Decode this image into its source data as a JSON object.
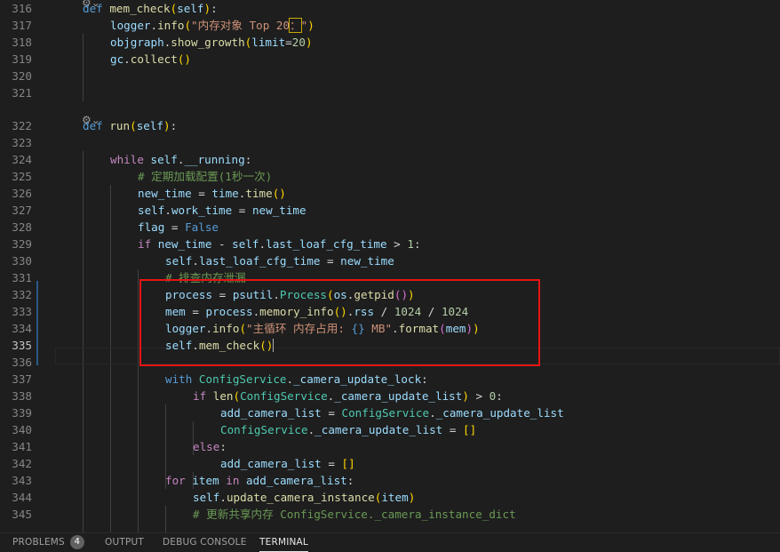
{
  "editor": {
    "lines": [
      {
        "n": "316",
        "seg": [
          [
            "kw",
            "def "
          ],
          [
            "fn",
            "mem_check"
          ],
          [
            "br1",
            "("
          ],
          [
            "var",
            "self"
          ],
          [
            "br1",
            ")"
          ],
          [
            "op",
            ":"
          ]
        ]
      },
      {
        "n": "317",
        "seg": [
          [
            "var",
            "logger"
          ],
          [
            "op",
            "."
          ],
          [
            "fn",
            "info"
          ],
          [
            "br1",
            "("
          ],
          [
            "str",
            "\"内存对象 Top 20"
          ],
          [
            "strhl",
            "："
          ],
          [
            "str",
            "\""
          ],
          [
            "br1",
            ")"
          ]
        ]
      },
      {
        "n": "318",
        "seg": [
          [
            "var",
            "objgraph"
          ],
          [
            "op",
            "."
          ],
          [
            "fn",
            "show_growth"
          ],
          [
            "br1",
            "("
          ],
          [
            "var",
            "limit"
          ],
          [
            "op",
            "="
          ],
          [
            "num",
            "20"
          ],
          [
            "br1",
            ")"
          ]
        ]
      },
      {
        "n": "319",
        "seg": [
          [
            "var",
            "gc"
          ],
          [
            "op",
            "."
          ],
          [
            "fn",
            "collect"
          ],
          [
            "br1",
            "()"
          ]
        ]
      },
      {
        "n": "320",
        "seg": []
      },
      {
        "n": "321",
        "seg": []
      },
      {
        "n": "322",
        "seg": [
          [
            "kw",
            "def "
          ],
          [
            "fn",
            "run"
          ],
          [
            "br1",
            "("
          ],
          [
            "var",
            "self"
          ],
          [
            "br1",
            ")"
          ],
          [
            "op",
            ":"
          ]
        ]
      },
      {
        "n": "323",
        "seg": []
      },
      {
        "n": "324",
        "seg": [
          [
            "ctl",
            "while "
          ],
          [
            "var",
            "self"
          ],
          [
            "op",
            "."
          ],
          [
            "var",
            "__running"
          ],
          [
            "op",
            ":"
          ]
        ]
      },
      {
        "n": "325",
        "seg": [
          [
            "cmt",
            "# 定期加载配置(1秒一次)"
          ]
        ]
      },
      {
        "n": "326",
        "seg": [
          [
            "var",
            "new_time"
          ],
          [
            "op",
            " = "
          ],
          [
            "var",
            "time"
          ],
          [
            "op",
            "."
          ],
          [
            "fn",
            "time"
          ],
          [
            "br1",
            "()"
          ]
        ]
      },
      {
        "n": "327",
        "seg": [
          [
            "var",
            "self"
          ],
          [
            "op",
            "."
          ],
          [
            "var",
            "work_time"
          ],
          [
            "op",
            " = "
          ],
          [
            "var",
            "new_time"
          ]
        ]
      },
      {
        "n": "328",
        "seg": [
          [
            "var",
            "flag"
          ],
          [
            "op",
            " = "
          ],
          [
            "kw",
            "False"
          ]
        ]
      },
      {
        "n": "329",
        "seg": [
          [
            "ctl",
            "if "
          ],
          [
            "var",
            "new_time"
          ],
          [
            "op",
            " - "
          ],
          [
            "var",
            "self"
          ],
          [
            "op",
            "."
          ],
          [
            "var",
            "last_loaf_cfg_time"
          ],
          [
            "op",
            " > "
          ],
          [
            "num",
            "1"
          ],
          [
            "op",
            ":"
          ]
        ]
      },
      {
        "n": "330",
        "seg": [
          [
            "var",
            "self"
          ],
          [
            "op",
            "."
          ],
          [
            "var",
            "last_loaf_cfg_time"
          ],
          [
            "op",
            " = "
          ],
          [
            "var",
            "new_time"
          ]
        ]
      },
      {
        "n": "331",
        "seg": [
          [
            "cmt",
            "# 排查内存泄漏"
          ]
        ]
      },
      {
        "n": "332",
        "seg": [
          [
            "var",
            "process"
          ],
          [
            "op",
            " = "
          ],
          [
            "var",
            "psutil"
          ],
          [
            "op",
            "."
          ],
          [
            "cls",
            "Process"
          ],
          [
            "br1",
            "("
          ],
          [
            "var",
            "os"
          ],
          [
            "op",
            "."
          ],
          [
            "fn",
            "getpid"
          ],
          [
            "br2",
            "()"
          ],
          [
            "br1",
            ")"
          ]
        ]
      },
      {
        "n": "333",
        "seg": [
          [
            "var",
            "mem"
          ],
          [
            "op",
            " = "
          ],
          [
            "var",
            "process"
          ],
          [
            "op",
            "."
          ],
          [
            "fn",
            "memory_info"
          ],
          [
            "br1",
            "()"
          ],
          [
            "op",
            "."
          ],
          [
            "var",
            "rss"
          ],
          [
            "op",
            " / "
          ],
          [
            "num",
            "1024"
          ],
          [
            "op",
            " / "
          ],
          [
            "num",
            "1024"
          ]
        ]
      },
      {
        "n": "334",
        "seg": [
          [
            "var",
            "logger"
          ],
          [
            "op",
            "."
          ],
          [
            "fn",
            "info"
          ],
          [
            "br1",
            "("
          ],
          [
            "str",
            "\"主循环 内存占用: "
          ],
          [
            "kw",
            "{}"
          ],
          [
            "str",
            " MB\""
          ],
          [
            "op",
            "."
          ],
          [
            "fn",
            "format"
          ],
          [
            "br2",
            "("
          ],
          [
            "var",
            "mem"
          ],
          [
            "br2",
            ")"
          ],
          [
            "br1",
            ")"
          ]
        ]
      },
      {
        "n": "335",
        "seg": [
          [
            "var",
            "self"
          ],
          [
            "op",
            "."
          ],
          [
            "fn",
            "mem_check"
          ],
          [
            "br1",
            "()"
          ]
        ]
      },
      {
        "n": "336",
        "seg": []
      },
      {
        "n": "337",
        "seg": [
          [
            "kw",
            "with "
          ],
          [
            "cls",
            "ConfigService"
          ],
          [
            "op",
            "."
          ],
          [
            "var",
            "_camera_update_lock"
          ],
          [
            "op",
            ":"
          ]
        ]
      },
      {
        "n": "338",
        "seg": [
          [
            "ctl",
            "if "
          ],
          [
            "fn",
            "len"
          ],
          [
            "br1",
            "("
          ],
          [
            "cls",
            "ConfigService"
          ],
          [
            "op",
            "."
          ],
          [
            "var",
            "_camera_update_list"
          ],
          [
            "br1",
            ")"
          ],
          [
            "op",
            " > "
          ],
          [
            "num",
            "0"
          ],
          [
            "op",
            ":"
          ]
        ]
      },
      {
        "n": "339",
        "seg": [
          [
            "var",
            "add_camera_list"
          ],
          [
            "op",
            " = "
          ],
          [
            "cls",
            "ConfigService"
          ],
          [
            "op",
            "."
          ],
          [
            "var",
            "_camera_update_list"
          ]
        ]
      },
      {
        "n": "340",
        "seg": [
          [
            "cls",
            "ConfigService"
          ],
          [
            "op",
            "."
          ],
          [
            "var",
            "_camera_update_list"
          ],
          [
            "op",
            " = "
          ],
          [
            "br1",
            "[]"
          ]
        ]
      },
      {
        "n": "341",
        "seg": [
          [
            "ctl",
            "else"
          ],
          [
            "op",
            ":"
          ]
        ]
      },
      {
        "n": "342",
        "seg": [
          [
            "var",
            "add_camera_list"
          ],
          [
            "op",
            " = "
          ],
          [
            "br1",
            "[]"
          ]
        ]
      },
      {
        "n": "343",
        "seg": [
          [
            "ctl",
            "for "
          ],
          [
            "var",
            "item"
          ],
          [
            "ctl",
            " in "
          ],
          [
            "var",
            "add_camera_list"
          ],
          [
            "op",
            ":"
          ]
        ]
      },
      {
        "n": "344",
        "seg": [
          [
            "var",
            "self"
          ],
          [
            "op",
            "."
          ],
          [
            "fn",
            "update_camera_instance"
          ],
          [
            "br1",
            "("
          ],
          [
            "var",
            "item"
          ],
          [
            "br1",
            ")"
          ]
        ]
      },
      {
        "n": "345",
        "seg": [
          [
            "cmt",
            "# 更新共享内存 ConfigService._camera_instance_dict"
          ]
        ]
      }
    ]
  },
  "panel": {
    "tabs": [
      {
        "label": "PROBLEMS",
        "badge": "4"
      },
      {
        "label": "OUTPUT"
      },
      {
        "label": "DEBUG CONSOLE"
      },
      {
        "label": "TERMINAL"
      }
    ]
  },
  "colors": {
    "background": "#1e1e1e",
    "highlight_box": "#e81414"
  },
  "icons": {
    "codelens": "refactor-lightbulb-icon"
  }
}
